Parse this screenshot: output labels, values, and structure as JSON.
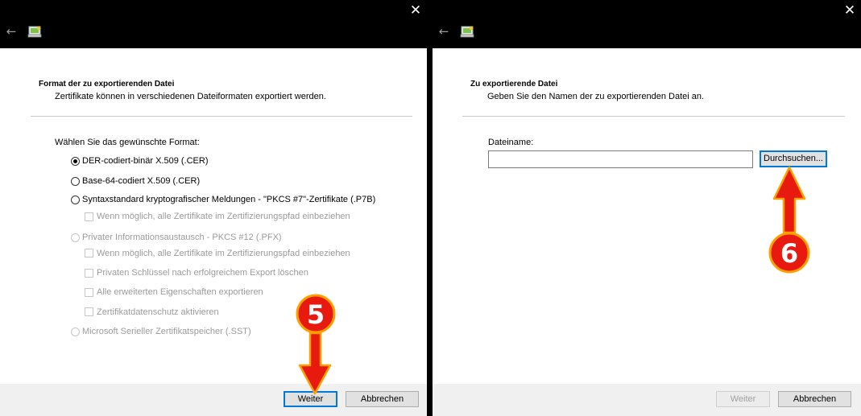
{
  "left_dialog": {
    "header_title": "Format der zu exportierenden Datei",
    "header_subtitle": "Zertifikate können in verschiedenen Dateiformaten exportiert werden.",
    "prompt": "Wählen Sie das gewünschte Format:",
    "options": [
      {
        "label": "DER-codiert-binär X.509 (.CER)",
        "selected": true,
        "enabled": true
      },
      {
        "label": "Base-64-codiert X.509 (.CER)",
        "selected": false,
        "enabled": true
      },
      {
        "label": "Syntaxstandard kryptografischer Meldungen - \"PKCS #7\"-Zertifikate (.P7B)",
        "selected": false,
        "enabled": true
      },
      {
        "label": "Privater Informationsaustausch - PKCS #12 (.PFX)",
        "selected": false,
        "enabled": false
      },
      {
        "label": "Microsoft Serieller Zertifikatspeicher (.SST)",
        "selected": false,
        "enabled": false
      }
    ],
    "p7b_checkbox": "Wenn möglich, alle Zertifikate im Zertifizierungspfad einbeziehen",
    "pfx_checkboxes": [
      "Wenn möglich, alle Zertifikate im Zertifizierungspfad einbeziehen",
      "Privaten Schlüssel nach erfolgreichem Export löschen",
      "Alle erweiterten Eigenschaften exportieren",
      "Zertifikatdatenschutz aktivieren"
    ],
    "next_button": "Weiter",
    "cancel_button": "Abbrechen",
    "step_badge": "5"
  },
  "right_dialog": {
    "header_title": "Zu exportierende Datei",
    "header_subtitle": "Geben Sie den Namen der zu exportierenden Datei an.",
    "filename_label": "Dateiname:",
    "filename_value": "",
    "browse_button": "Durchsuchen...",
    "next_button": "Weiter",
    "cancel_button": "Abbrechen",
    "step_badge": "6"
  },
  "icons": {
    "close": "close-icon",
    "back": "back-arrow-icon",
    "wizard": "certificate-wizard-icon"
  },
  "colors": {
    "accent": "#0078d7",
    "annotation_red": "#e8190f",
    "annotation_outline": "#ffa000"
  }
}
